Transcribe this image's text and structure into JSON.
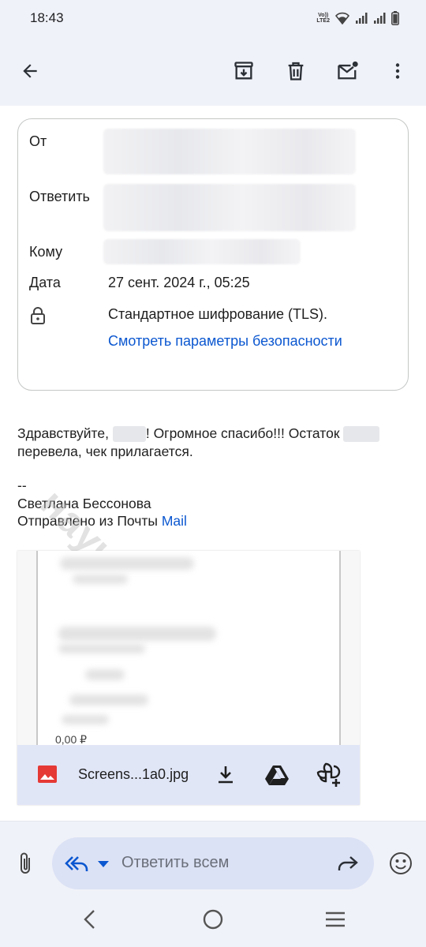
{
  "status_bar": {
    "time": "18:43",
    "volte_top": "Vo))",
    "volte_bottom": "LTE2"
  },
  "email_header": {
    "from_label": "От",
    "reply_to_label": "Ответить",
    "to_label": "Кому",
    "date_label": "Дата",
    "date_value": "27 сент. 2024 г., 05:25",
    "encryption_text": "Стандартное шифрование (TLS).",
    "security_link": "Смотреть параметры безопасности"
  },
  "message": {
    "greeting_start": "Здравствуйте,",
    "greeting_rest": "! Огромное спасибо!!! Остаток",
    "line2": "перевела, чек прилагается.",
    "separator": "--",
    "signature_name": "Светлана Бессонова",
    "sent_from": "Отправлено из Почты",
    "sent_from_link": "Mail"
  },
  "attachment": {
    "file_name": "Screens...1a0.jpg",
    "preview_amount": "0,00 ₽"
  },
  "reply_bar": {
    "placeholder": "Ответить всем"
  },
  "watermark": "научные-статьи.рф",
  "colors": {
    "accent": "#0b57d0",
    "surface": "#f0f2f9",
    "attachment_footer": "#e1e6f7",
    "image_icon": "#e53935"
  },
  "icons": [
    "back-arrow-icon",
    "archive-icon",
    "trash-icon",
    "mark-unread-icon",
    "more-vert-icon",
    "lock-icon",
    "image-file-icon",
    "download-icon",
    "drive-icon",
    "add-to-photos-icon",
    "attach-icon",
    "reply-all-icon",
    "dropdown-icon",
    "forward-icon",
    "emoji-icon",
    "nav-back-icon",
    "nav-home-icon",
    "nav-recents-icon"
  ]
}
